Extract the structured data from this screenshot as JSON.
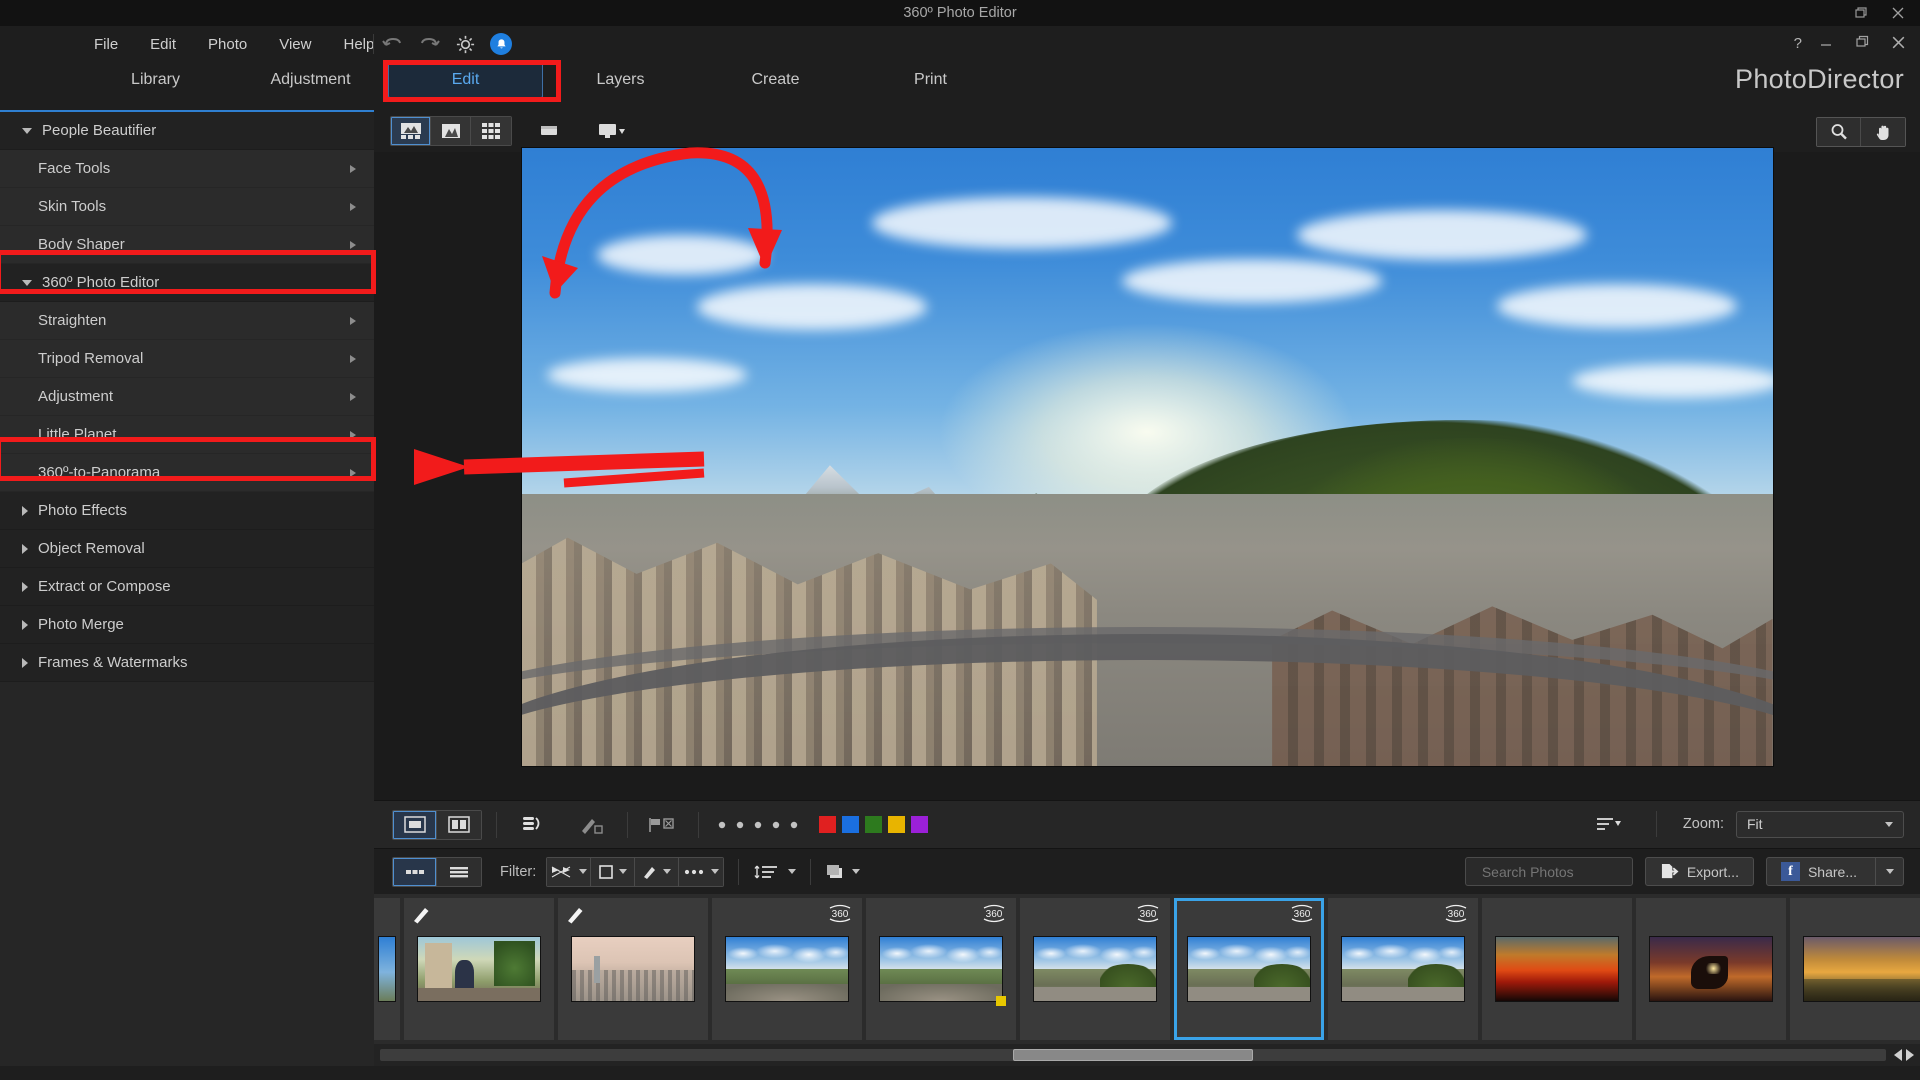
{
  "window": {
    "title": "360º Photo Editor",
    "brand": "PhotoDirector",
    "help_glyph": "?",
    "controls": {
      "restore_small": "restore-small",
      "close_small": "close-small",
      "minimize": "minimize",
      "maximize": "maximize",
      "close": "close"
    }
  },
  "menubar": {
    "items": [
      "File",
      "Edit",
      "Photo",
      "View",
      "Help"
    ],
    "tools": [
      "undo-icon",
      "redo-icon",
      "settings-gear-icon",
      "notification-bell-icon"
    ]
  },
  "tabs": [
    {
      "label": "Library",
      "active": false
    },
    {
      "label": "Adjustment",
      "active": false
    },
    {
      "label": "Edit",
      "active": true
    },
    {
      "label": "Layers",
      "active": false
    },
    {
      "label": "Create",
      "active": false
    },
    {
      "label": "Print",
      "active": false
    }
  ],
  "sidebar": {
    "items": [
      {
        "label": "People Beautifier",
        "type": "group",
        "expanded": true,
        "highlight": false
      },
      {
        "label": "Face Tools",
        "type": "child",
        "chevron": true,
        "highlight": false
      },
      {
        "label": "Skin Tools",
        "type": "child",
        "chevron": true,
        "highlight": false
      },
      {
        "label": "Body Shaper",
        "type": "child",
        "chevron": true,
        "highlight": false
      },
      {
        "label": "360º Photo Editor",
        "type": "group",
        "expanded": true,
        "highlight": true
      },
      {
        "label": "Straighten",
        "type": "child",
        "chevron": true,
        "highlight": false
      },
      {
        "label": "Tripod Removal",
        "type": "child",
        "chevron": true,
        "highlight": false
      },
      {
        "label": "Adjustment",
        "type": "child",
        "chevron": true,
        "highlight": false
      },
      {
        "label": "Little Planet",
        "type": "child",
        "chevron": true,
        "highlight": false
      },
      {
        "label": "360º-to-Panorama",
        "type": "child",
        "chevron": true,
        "highlight": true
      },
      {
        "label": "Photo Effects",
        "type": "group",
        "expanded": false,
        "highlight": false
      },
      {
        "label": "Object Removal",
        "type": "group",
        "expanded": false,
        "highlight": false
      },
      {
        "label": "Extract or Compose",
        "type": "group",
        "expanded": false,
        "highlight": false
      },
      {
        "label": "Photo Merge",
        "type": "group",
        "expanded": false,
        "highlight": false
      },
      {
        "label": "Frames & Watermarks",
        "type": "group",
        "expanded": false,
        "highlight": false
      }
    ]
  },
  "viewer_toolbar": {
    "view_modes": [
      "filmstrip-view-icon",
      "single-photo-icon",
      "grid-view-icon"
    ],
    "extra": [
      "compare-icon",
      "second-monitor-icon"
    ],
    "right_tools": [
      "zoom-magnifier-icon",
      "pan-hand-icon"
    ]
  },
  "options_bar": {
    "layout_modes": [
      "single-view-icon",
      "split-view-icon"
    ],
    "tools": [
      "rotate-icon",
      "paint-icon",
      "flag-reject-icon",
      "rating-dots-icon"
    ],
    "color_tags": [
      "#e02020",
      "#1a6fe0",
      "#2d7a1e",
      "#e8b400",
      "#9b20d8"
    ],
    "sort_icon": "sort-order-icon",
    "zoom_label": "Zoom:",
    "zoom_value": "Fit"
  },
  "filter_bar": {
    "view_modes": [
      "thumbnail-list-icon",
      "detail-list-icon"
    ],
    "filter_label": "Filter:",
    "dropdowns": [
      "flag-filter-icon",
      "rating-filter-icon",
      "edit-filter-icon",
      "more-filter-icon"
    ],
    "sort_dropdown": "sort-dropdown-icon",
    "stack_dropdown": "stack-dropdown-icon",
    "search_placeholder": "Search Photos",
    "search_value": "",
    "clear_icon": "clear-x-icon",
    "export_label": "Export...",
    "share_label": "Share...",
    "share_icon": "facebook-icon"
  },
  "filmstrip": {
    "items": [
      {
        "name": "thumb-partial-left",
        "kind": "partial",
        "selected": false,
        "badge": "",
        "edited": false
      },
      {
        "name": "thumb-balcony",
        "kind": "photo-balcony",
        "selected": false,
        "badge": "",
        "edited": true
      },
      {
        "name": "thumb-city-skyline",
        "kind": "photo-city",
        "selected": false,
        "badge": "",
        "edited": true
      },
      {
        "name": "thumb-360-park-1",
        "kind": "photo-360-park",
        "selected": false,
        "badge": "360",
        "edited": false
      },
      {
        "name": "thumb-360-park-2",
        "kind": "photo-360-park",
        "selected": false,
        "badge": "360",
        "edited": false
      },
      {
        "name": "thumb-360-town-1",
        "kind": "photo-360-town",
        "selected": false,
        "badge": "360",
        "edited": false
      },
      {
        "name": "thumb-360-town-selected",
        "kind": "photo-360-town",
        "selected": true,
        "badge": "360",
        "edited": false
      },
      {
        "name": "thumb-360-town-2",
        "kind": "photo-360-town",
        "selected": false,
        "badge": "360",
        "edited": false
      },
      {
        "name": "thumb-sunset-birds",
        "kind": "photo-sunset",
        "selected": false,
        "badge": "",
        "edited": false
      },
      {
        "name": "thumb-sunset-hand",
        "kind": "photo-hand-sun",
        "selected": false,
        "badge": "",
        "edited": false
      },
      {
        "name": "thumb-sunset-field",
        "kind": "photo-field-sun",
        "selected": false,
        "badge": "",
        "edited": false
      }
    ]
  },
  "scrollbar": {
    "left_arrow": "scroll-left-arrow",
    "right_arrow": "scroll-right-arrow"
  },
  "annotations": {
    "accent_color": "#f21b1b",
    "boxes": [
      "edit-tab-highlight",
      "360-photo-editor-highlight",
      "360-to-panorama-highlight"
    ],
    "arrows": [
      "curved-arrow-to-toolbar",
      "straight-arrow-to-360-to-panorama"
    ]
  }
}
